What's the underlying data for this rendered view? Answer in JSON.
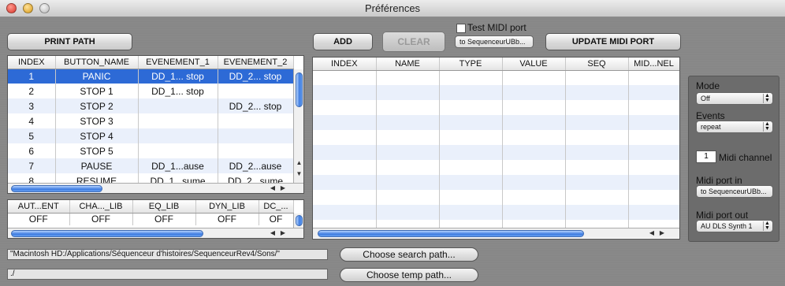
{
  "window": {
    "title": "Préférences"
  },
  "toolbar": {
    "print_path": "PRINT PATH",
    "add": "ADD",
    "clear": "CLEAR",
    "test_midi_port": "Test MIDI port",
    "test_port_select": "to SequenceurUBb...",
    "update_midi_port": "UPDATE MIDI PORT"
  },
  "buttons_table": {
    "columns": [
      "INDEX",
      "BUTTON_NAME",
      "EVENEMENT_1",
      "EVENEMENT_2"
    ],
    "rows": [
      [
        "1",
        "PANIC",
        "DD_1... stop",
        "DD_2... stop"
      ],
      [
        "2",
        "STOP 1",
        "DD_1... stop",
        ""
      ],
      [
        "3",
        "STOP 2",
        "",
        "DD_2... stop"
      ],
      [
        "4",
        "STOP 3",
        "",
        ""
      ],
      [
        "5",
        "STOP 4",
        "",
        ""
      ],
      [
        "6",
        "STOP 5",
        "",
        ""
      ],
      [
        "7",
        "PAUSE",
        "DD_1...ause",
        "DD_2...ause"
      ],
      [
        "8",
        "RESUME",
        "DD_1...sume",
        "DD_2...sume"
      ]
    ],
    "selected_index": 0
  },
  "lib_table": {
    "columns": [
      "AUT...ENT",
      "CHA..._LIB",
      "EQ_LIB",
      "DYN_LIB",
      "DC_..."
    ],
    "rows": [
      [
        "OFF",
        "OFF",
        "OFF",
        "OFF",
        "OF"
      ]
    ]
  },
  "events_table": {
    "columns": [
      "INDEX",
      "NAME",
      "TYPE",
      "VALUE",
      "SEQ",
      "MID...NEL"
    ]
  },
  "midi_panel": {
    "mode_label": "Mode",
    "mode_value": "Off",
    "events_label": "Events",
    "events_value": "repeat",
    "channel_value": "1",
    "channel_label": "Midi channel",
    "port_in_label": "Midi port in",
    "port_in_value": "to SequenceurUBb...",
    "port_out_label": "Midi port out",
    "port_out_value": "AU DLS Synth 1"
  },
  "paths": {
    "search_path": "\"Macintosh HD:/Applications/Séquenceur d'histoires/SequenceurRev4/Sons/\"",
    "choose_search": "Choose search path...",
    "temp_path": "./",
    "choose_temp": "Choose temp path..."
  }
}
